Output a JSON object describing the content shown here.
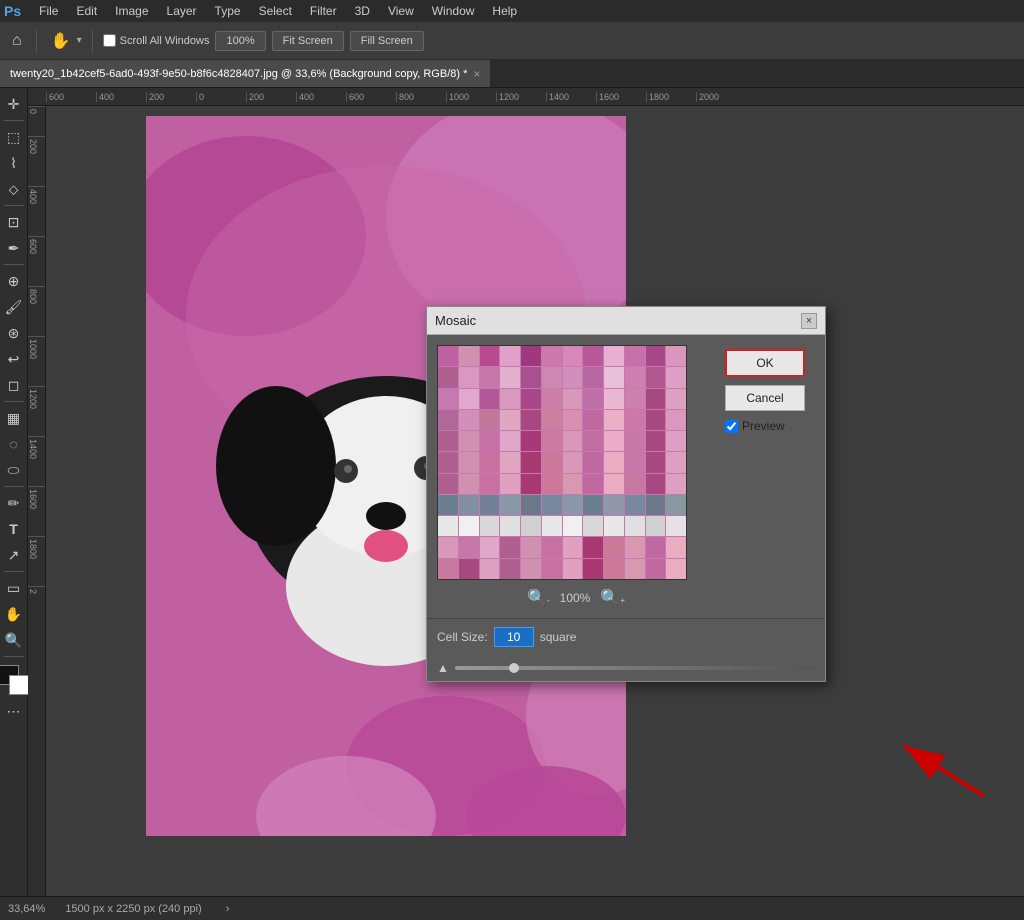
{
  "app": {
    "name": "Photoshop",
    "logo": "Ps"
  },
  "menu": {
    "items": [
      "File",
      "Edit",
      "Image",
      "Layer",
      "Type",
      "Select",
      "Filter",
      "3D",
      "View",
      "Window",
      "Help"
    ]
  },
  "toolbar": {
    "scroll_all_label": "Scroll All Windows",
    "zoom_level": "100%",
    "fit_screen": "Fit Screen",
    "fill_screen": "Fill Screen"
  },
  "tab": {
    "title": "twenty20_1b42cef5-6ad0-493f-9e50-b8f6c4828407.jpg @ 33,6% (Background copy, RGB/8) *",
    "close": "×"
  },
  "ruler": {
    "top_marks": [
      "600",
      "400",
      "200",
      "0",
      "200",
      "400",
      "600",
      "800",
      "1000",
      "1200",
      "1400",
      "1600",
      "1800",
      "2000"
    ],
    "left_marks": [
      "0",
      "2\n0\n0",
      "4\n0\n0",
      "6\n0\n0",
      "8\n0\n0",
      "1\n0\n0\n0",
      "1\n2\n0\n0",
      "1\n4\n0\n0",
      "1\n6\n0\n0",
      "1\n8\n0\n0",
      "2"
    ]
  },
  "dialog": {
    "title": "Mosaic",
    "close_btn": "×",
    "ok_label": "OK",
    "cancel_label": "Cancel",
    "preview_label": "Preview",
    "zoom_percent": "100%",
    "cell_size_label": "Cell Size:",
    "cell_size_value": "10",
    "cell_size_unit": "square",
    "preview_checked": true
  },
  "mosaic_colors": [
    "#c060a0",
    "#d090b0",
    "#b84890",
    "#e0a0c8",
    "#a03880",
    "#cc78aa",
    "#d888b8",
    "#b85898",
    "#e8b0d0",
    "#c870a8",
    "#a84888",
    "#dc96be",
    "#b06090",
    "#d898c0",
    "#c878a8",
    "#e0b0cc",
    "#a85090",
    "#cc88b0",
    "#d090be",
    "#b868a0",
    "#e8c0d8",
    "#d080b0",
    "#b05890",
    "#dca0c4",
    "#c878b0",
    "#e0a8cc",
    "#b05898",
    "#d898c0",
    "#a84888",
    "#cc80a8",
    "#d898b8",
    "#c070a8",
    "#eab8d0",
    "#cc80b0",
    "#a84880",
    "#dca0c0",
    "#b06898",
    "#d090b8",
    "#c07898",
    "#e0a8c0",
    "#a84880",
    "#cc80a0",
    "#d890b0",
    "#c068a0",
    "#eab0c8",
    "#cc78a8",
    "#a84880",
    "#dc98bc",
    "#b06090",
    "#d090b0",
    "#c870a8",
    "#e0a8c8",
    "#a83878",
    "#cc7aa0",
    "#d898b8",
    "#c070a0",
    "#eaacc8",
    "#c878a8",
    "#a84880",
    "#dca0c4",
    "#b06090",
    "#d090b0",
    "#c870a0",
    "#e0a8c0",
    "#a83870",
    "#cc7898",
    "#d898b8",
    "#c068a0",
    "#eaacc0",
    "#c878a8",
    "#a84880",
    "#dca0c0",
    "#b06090",
    "#d090b0",
    "#c870a0",
    "#e0a0c0",
    "#a83870",
    "#cc7898",
    "#d898b0",
    "#c068a0",
    "#eaacc0",
    "#c878a0",
    "#a84880",
    "#dca0c0",
    "#6a8090",
    "#8090a0",
    "#708098",
    "#8898a8",
    "#6a7888",
    "#7888a0",
    "#8898a8",
    "#6a8090",
    "#9098a8",
    "#7888a0",
    "#6a7888",
    "#8898a0",
    "#e8e8e8",
    "#f0f0f0",
    "#d8d8d8",
    "#e0e0e0",
    "#d0d0d0",
    "#e8e8e8",
    "#f0f0f0",
    "#d8d8d8",
    "#e8e8e8",
    "#e0e0e0",
    "#d0d0d0",
    "#e8e0e8",
    "#d898b8",
    "#c878a8",
    "#e0a8c8",
    "#b06090",
    "#d090b0",
    "#c870a0",
    "#e0a0c0",
    "#a83870",
    "#cc7898",
    "#d898b0",
    "#c068a0",
    "#eaacc0",
    "#c878a0",
    "#a84880",
    "#dca0c0",
    "#b06090",
    "#d090b0",
    "#c870a0",
    "#e0a0c0",
    "#a83870",
    "#cc7898",
    "#d898b0",
    "#c068a0",
    "#eaacc0"
  ],
  "status_bar": {
    "zoom": "33,64%",
    "dimensions": "1500 px x 2250 px (240 ppi)"
  }
}
